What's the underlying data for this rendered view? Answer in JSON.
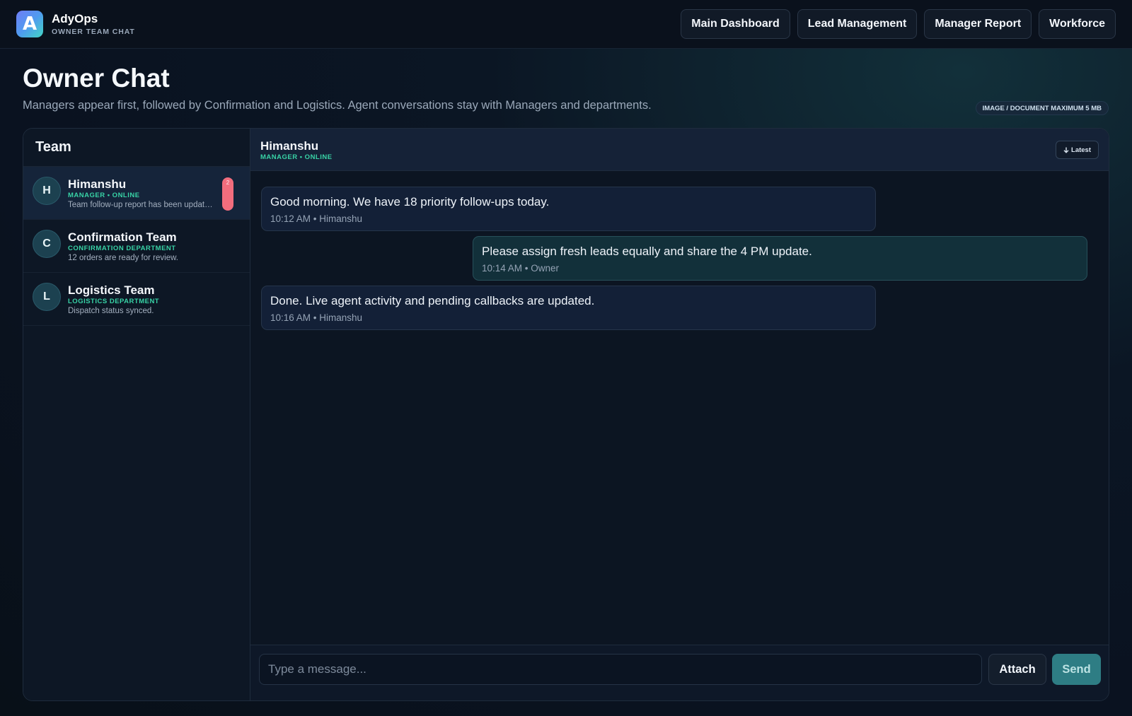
{
  "brand": {
    "logo_letter": "A",
    "name": "AdyOps",
    "subtitle": "OWNER TEAM CHAT"
  },
  "nav": [
    {
      "label": "Main Dashboard"
    },
    {
      "label": "Lead Management"
    },
    {
      "label": "Manager Report"
    },
    {
      "label": "Workforce"
    }
  ],
  "page": {
    "title": "Owner Chat",
    "subtitle": "Managers appear first, followed by Confirmation and Logistics. Agent conversations stay with Managers and departments.",
    "limit_badge": "IMAGE / DOCUMENT MAXIMUM 5 MB"
  },
  "sidebar": {
    "title": "Team",
    "contacts": [
      {
        "initial": "H",
        "name": "Himanshu",
        "role": "MANAGER • ONLINE",
        "preview": "Team follow-up report has been updated.",
        "unread": "2",
        "active": true
      },
      {
        "initial": "C",
        "name": "Confirmation Team",
        "role": "CONFIRMATION DEPARTMENT",
        "preview": "12 orders are ready for review."
      },
      {
        "initial": "L",
        "name": "Logistics Team",
        "role": "LOGISTICS DEPARTMENT",
        "preview": "Dispatch status synced."
      }
    ]
  },
  "chat": {
    "name": "Himanshu",
    "status": "MANAGER • ONLINE",
    "latest_label": "Latest",
    "latest_icon": "arrow-down-icon",
    "messages": [
      {
        "direction": "in",
        "text": "Good morning. We have 18 priority follow-ups today.",
        "meta": "10:12 AM • Himanshu"
      },
      {
        "direction": "out",
        "text": "Please assign fresh leads equally and share the 4 PM update.",
        "meta": "10:14 AM • Owner"
      },
      {
        "direction": "in",
        "text": "Done. Live agent activity and pending callbacks are updated.",
        "meta": "10:16 AM • Himanshu"
      }
    ]
  },
  "composer": {
    "placeholder": "Type a message...",
    "attach_label": "Attach",
    "send_label": "Send"
  },
  "colors": {
    "accent_green": "#38d3a6",
    "unread_badge": "#f26d7d",
    "send_button": "#2e7d84"
  }
}
